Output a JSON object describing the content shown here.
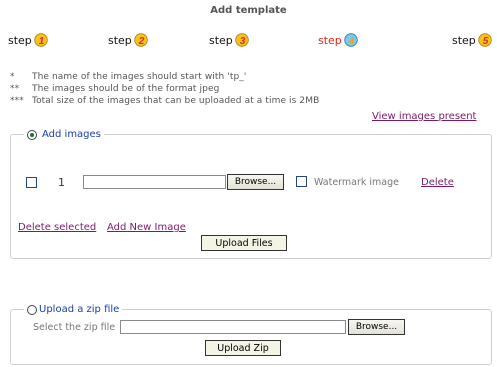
{
  "page": {
    "title": "Add template"
  },
  "steps": [
    {
      "label": "step",
      "number": "1",
      "color": "#e94b1c"
    },
    {
      "label": "step",
      "number": "2",
      "color": "#e94b1c"
    },
    {
      "label": "step",
      "number": "3",
      "color": "#e94b1c"
    },
    {
      "label": "step",
      "number": "4",
      "color": "#f4a21c",
      "active": true
    },
    {
      "label": "step",
      "number": "5",
      "color": "#e94b1c"
    }
  ],
  "notes": [
    {
      "marker": "*",
      "text": "The name of the images should start with 'tp_'"
    },
    {
      "marker": "**",
      "text": "The images should be of the format jpeg"
    },
    {
      "marker": "***",
      "text": "Total size of the images that can be uploaded at a time is 2MB"
    }
  ],
  "view_images_link": "View images present",
  "add_images": {
    "option_label": "Add images",
    "row": {
      "number": "1",
      "file_value": "",
      "browse_label": "Browse...",
      "watermark_label": "Watermark image",
      "delete_label": "Delete"
    },
    "delete_selected_label": "Delete selected",
    "add_new_label": "Add New Image",
    "upload_label": "Upload Files"
  },
  "zip": {
    "option_label": "Upload a zip file",
    "field_label": "Select the zip file",
    "file_value": "",
    "browse_label": "Browse...",
    "upload_label": "Upload Zip"
  },
  "colors": {
    "active_step": "#e3261b",
    "link": "#7a1a6a",
    "legend": "#1a3fa0",
    "panel_border": "#cfcfcf"
  }
}
